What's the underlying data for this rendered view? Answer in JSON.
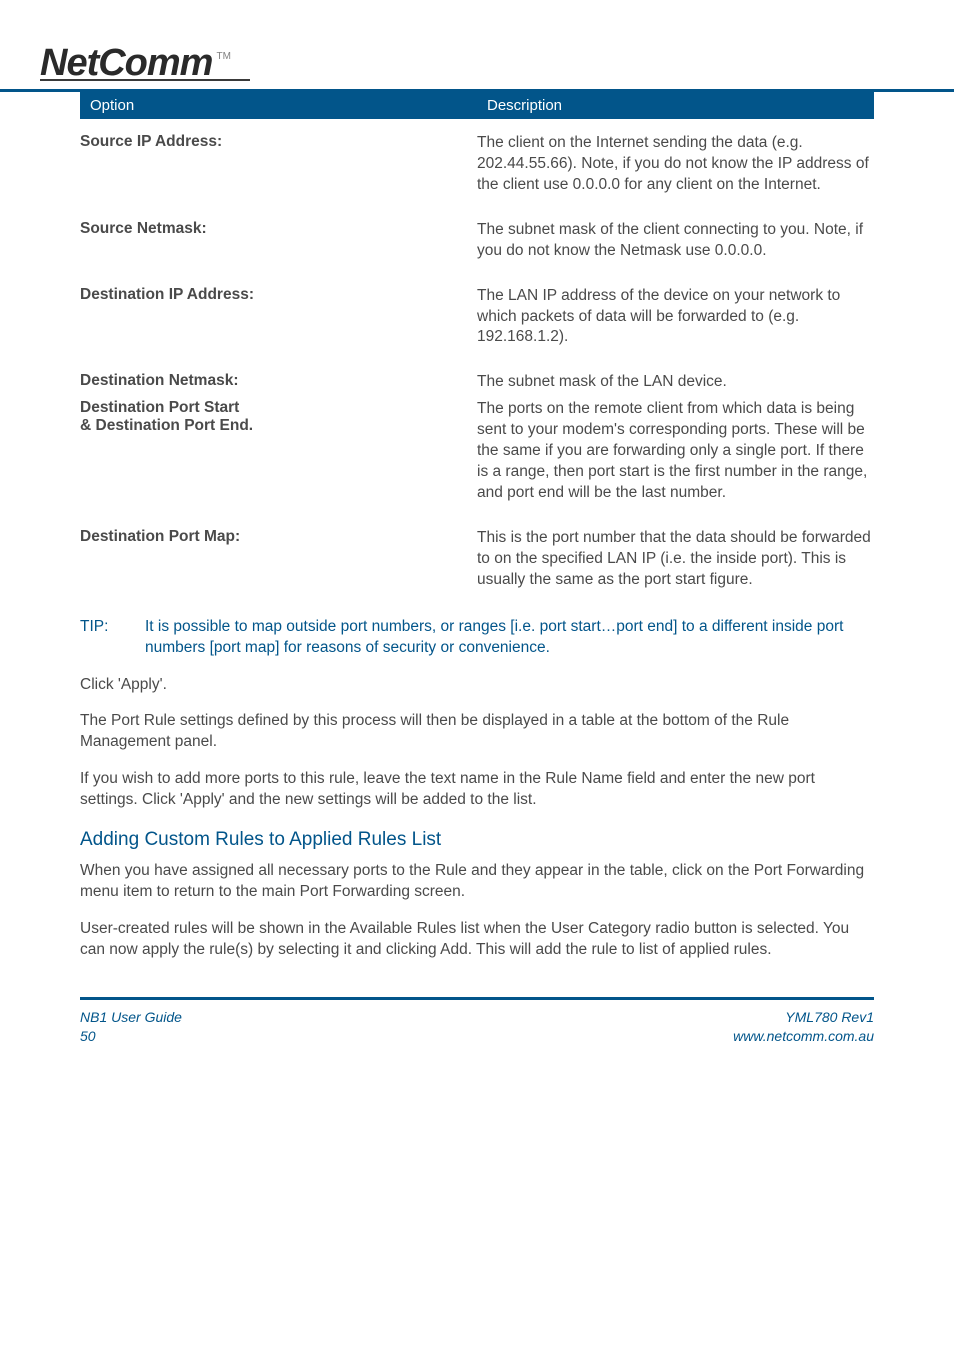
{
  "logo": {
    "main": "NetComm",
    "tm": "TM"
  },
  "table_header": {
    "left": "Option",
    "right": "Description"
  },
  "rows": [
    {
      "label": "Source IP Address:",
      "desc": "The client on the Internet sending the data (e.g. 202.44.55.66). Note, if you do not know the IP address of the client use 0.0.0.0 for any client on the Internet."
    },
    {
      "label": "Source Netmask:",
      "desc": "The subnet mask  of the client connecting to you. Note, if you do not know the Netmask use 0.0.0.0."
    },
    {
      "label": "Destination IP Address:",
      "desc": "The LAN IP address of the device on your network to which packets of data will be forwarded to (e.g. 192.168.1.2)."
    },
    {
      "label": "Destination Netmask:",
      "desc": "The subnet mask of the LAN device."
    },
    {
      "label": "Destination Port Start\n& Destination Port End.",
      "desc": "The ports on the remote client from which data is being sent to your modem's corresponding ports. These will be the same if you are forwarding only a single port.  If there is a range, then port start is the first number in the range, and port end will be the last number."
    },
    {
      "label": "Destination Port Map:",
      "desc": "This is the port number that the data should be forwarded to on the specified LAN IP (i.e. the inside port).  This is usually the same as the port start figure."
    }
  ],
  "tip": {
    "label": "TIP:",
    "text": "It is possible to map outside port numbers, or ranges [i.e. port start…port end] to a different inside port numbers [port map] for reasons of security or convenience."
  },
  "paragraphs": [
    "Click 'Apply'.",
    "The Port Rule settings defined by this process will then be displayed in a table at the bottom of the Rule Management panel.",
    "If you wish to add more ports to this rule, leave the text name in the Rule Name field and enter the new port settings. Click 'Apply' and the new settings will be added to the list."
  ],
  "section_heading": "Adding Custom Rules to Applied Rules List",
  "section_paragraphs": [
    "When you have assigned all necessary ports to the Rule and they appear in the table, click on the Port Forwarding menu item to return to the main Port Forwarding screen.",
    "User-created rules will be shown in the Available Rules list when the User Category radio button is selected. You can now apply the rule(s) by selecting it and clicking Add. This will add the rule to list of applied rules."
  ],
  "footer": {
    "left_line1": "NB1 User Guide",
    "left_line2": "50",
    "right_line1": "YML780 Rev1",
    "right_line2": "www.netcomm.com.au"
  }
}
